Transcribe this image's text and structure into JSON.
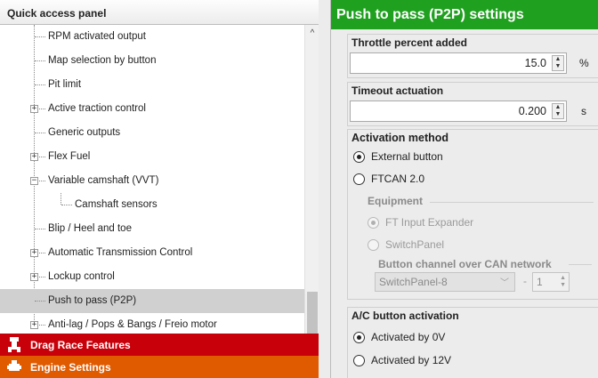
{
  "quick_access": {
    "title": "Quick access panel",
    "items": [
      {
        "label": "RPM activated output"
      },
      {
        "label": "Map selection by button"
      },
      {
        "label": "Pit limit"
      },
      {
        "label": "Active traction control",
        "expander": "+"
      },
      {
        "label": "Generic outputs"
      },
      {
        "label": "Flex Fuel",
        "expander": "+"
      },
      {
        "label": "Variable camshaft (VVT)",
        "expander": "−"
      },
      {
        "label": "Camshaft sensors"
      },
      {
        "label": "Blip / Heel and toe"
      },
      {
        "label": "Automatic Transmission Control",
        "expander": "+"
      },
      {
        "label": "Lockup control",
        "expander": "+"
      },
      {
        "label": "Push to pass (P2P)",
        "selected": true
      },
      {
        "label": "Anti-lag / Pops & Bangs / Freio motor",
        "expander": "+"
      }
    ],
    "categories": [
      {
        "label": "Drag Race Features",
        "color": "#c8000a",
        "icon": "dragster-icon"
      },
      {
        "label": "Engine Settings",
        "color": "#e05a00",
        "icon": "engine-icon"
      }
    ],
    "scroll_up_glyph": "^"
  },
  "p2p": {
    "title": "Push to pass (P2P) settings",
    "title_color": "#1fa01f",
    "throttle": {
      "label": "Throttle percent added",
      "value": "15.0",
      "unit": "%"
    },
    "timeout": {
      "label": "Timeout actuation",
      "value": "0.200",
      "unit": "s"
    },
    "activation": {
      "label": "Activation method",
      "options": [
        {
          "label": "External button",
          "checked": true
        },
        {
          "label": "FTCAN 2.0",
          "checked": false
        }
      ],
      "equipment": {
        "label": "Equipment",
        "options": [
          {
            "label": "FT Input Expander",
            "checked": true
          },
          {
            "label": "SwitchPanel",
            "checked": false
          }
        ],
        "channel_label": "Button channel over CAN network",
        "channel_value": "SwitchPanel-8",
        "channel_sep": "-",
        "channel_index": "1"
      }
    },
    "ac": {
      "label": "A/C button activation",
      "options": [
        {
          "label": "Activated by 0V",
          "checked": true
        },
        {
          "label": "Activated by 12V",
          "checked": false
        }
      ]
    }
  }
}
